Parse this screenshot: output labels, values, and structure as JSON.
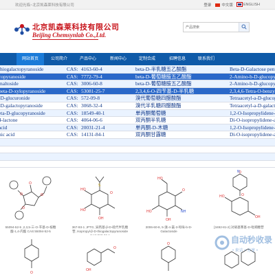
{
  "topbar": {
    "welcome": "欢迎光临~北京凯森莱科技有限公司",
    "login": "登录",
    "lang_cn": "中文版",
    "lang_en": "ENGLISH"
  },
  "header": {
    "logo_cn": "北京凯森莱科技有限公司",
    "logo_en": "Beijing Chemsynlab Co.,Ltd.",
    "search_placeholder": "产品搜索",
    "icons": {
      "search": "search-icon",
      "logo": "molecule-logo-icon"
    }
  },
  "nav": {
    "items": [
      {
        "label": "网站首页",
        "active": true
      },
      {
        "label": "公司简介",
        "active": false
      },
      {
        "label": "产品中心",
        "active": false
      },
      {
        "label": "新闻中心",
        "active": false
      },
      {
        "label": "定制合成",
        "active": false
      },
      {
        "label": "招聘信息",
        "active": false
      },
      {
        "label": "联系我们",
        "active": false
      }
    ]
  },
  "ticker": {
    "rows": [
      {
        "name": "thiogalactopyranoside",
        "cas_label": "CAS:",
        "cas": "4163-60-4",
        "cn": "beta-D-半乳糖五乙酸酯",
        "desc": "Beta-D-Galactose pentaacetate",
        "style": "alt"
      },
      {
        "name": "copyranoside",
        "cas_label": "CAS:",
        "cas": "7772-79-4",
        "cn": "beta-D-葡萄糖胺五乙酸酯",
        "desc": "2-Amino-b-D-glucopyranose",
        "style": "hl"
      },
      {
        "name": "maltoside",
        "cas_label": "CAS:",
        "cas": "3006-60-8",
        "cn": "beta-D-葡萄糖胺五乙酸酯",
        "desc": "2-Amino-b-D-glucopyranose",
        "style": "alt"
      },
      {
        "name": "beta-D-xylopyranoside",
        "cas_label": "CAS:",
        "cas": "53081-25-7",
        "cn": "2,3,4,6-O-四苄基-D-半乳糖",
        "desc": "2,3,4,6-Tetra-O-benzyl-D-galactose",
        "style": "hl"
      },
      {
        "name": "-D-glucuronide",
        "cas_label": "CAS:",
        "cas": "572-09-8",
        "cn": "溴代葡萄糖四醋酸酯",
        "desc": "Tetraacetyl-a-D-glucopyranosyl",
        "style": "alt"
      },
      {
        "name": "-D-galactopyranoside",
        "cas_label": "CAS:",
        "cas": "3068-32-4",
        "cn": "溴代半乳糖四醋酸酯",
        "desc": "Tetraacetyl-a-D-galactopyranosyl",
        "style": "plain"
      },
      {
        "name": "eta-D-glucopyranoside",
        "cas_label": "CAS:",
        "cas": "18549-40-1",
        "cn": "单丙酮葡萄糖",
        "desc": "1,2-O-Isopropylidene-a-D-glucofuranose",
        "style": "alt"
      },
      {
        "name": "4-lactone",
        "cas_label": "CAS:",
        "cas": "4064-06-6",
        "cn": "双丙酮半乳糖",
        "desc": "Di-O-isopropylidene-a-D-galactopyranose",
        "style": "plain"
      },
      {
        "name": "acid",
        "cas_label": "CAS:",
        "cas": "20031-21-4",
        "cn": "单丙酮-D-木糖",
        "desc": "1,2-O-Isopropylidene-D-xylofuranose",
        "style": "alt"
      },
      {
        "name": "nic acid",
        "cas_label": "CAS:",
        "cas": "14131-84-1",
        "cn": "双丙酮甘露糖",
        "desc": "Di-O-isopropylidene-a-D-mannofuranose",
        "style": "plain"
      },
      {
        "name": "",
        "cas_label": "",
        "cas": "",
        "cn": "",
        "desc": "",
        "style": "alt"
      },
      {
        "name": "",
        "cas_label": "",
        "cas": "",
        "cn": "",
        "desc": "",
        "style": "plain"
      },
      {
        "name": "",
        "cas_label": "",
        "cas": "",
        "cn": "",
        "desc": "",
        "style": "alt"
      },
      {
        "name": "",
        "cas_label": "",
        "cas": "",
        "cn": "",
        "desc": "",
        "style": "plain"
      }
    ]
  },
  "products": {
    "items": [
      {
        "caption": "55094-52-5 ,2,3,5-三-O-苄基-D-核糖酸-1,4-内酯 CAS:55094-52-5"
      },
      {
        "caption": "367-93-1 ,IPTG, 异丙基-β-D-硫代半乳糖苷, Isopropyl-β-D-thiogalactopyranoside CAS:367-93-1"
      },
      {
        "caption": "3006-60-8, 5-溴-4-氯-3-吲哚-b-D-Galactoside"
      },
      {
        "caption": "[3492-81-2] 对硝基苯基-D-吡喃糖苷"
      }
    ]
  },
  "watermark": {
    "text": "自动秒收录",
    "sub": "• 来访 • 分享 •"
  }
}
